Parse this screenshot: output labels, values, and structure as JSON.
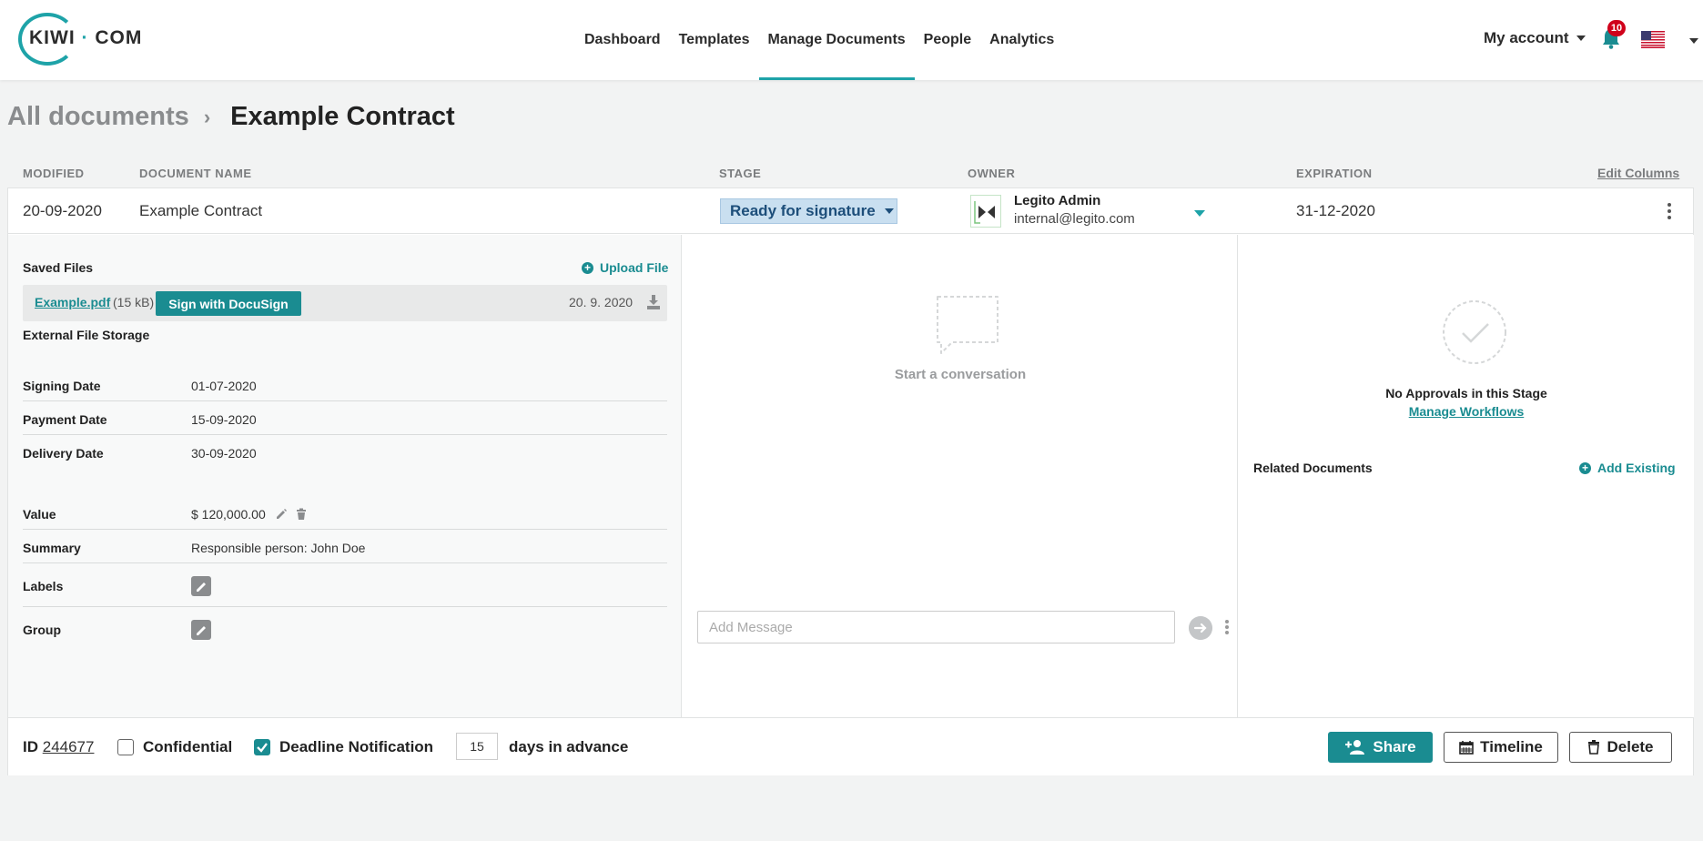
{
  "header": {
    "logo_left": "KIWI",
    "logo_dot": "·",
    "logo_right": "COM",
    "nav": [
      {
        "label": "Dashboard"
      },
      {
        "label": "Templates"
      },
      {
        "label": "Manage Documents",
        "active": true
      },
      {
        "label": "People"
      },
      {
        "label": "Analytics"
      }
    ],
    "account_label": "My account",
    "notification_count": "10",
    "flag_icon": "us-flag-icon"
  },
  "breadcrumb": {
    "parent": "All documents",
    "separator": "›",
    "current": "Example Contract"
  },
  "columns": {
    "modified": "MODIFIED",
    "document_name": "DOCUMENT NAME",
    "stage": "STAGE",
    "owner": "OWNER",
    "expiration": "EXPIRATION",
    "edit_columns": "Edit Columns"
  },
  "document": {
    "modified": "20-09-2020",
    "name": "Example Contract",
    "stage": "Ready for signature",
    "owner_name": "Legito Admin",
    "owner_email": "internal@legito.com",
    "expiration": "31-12-2020"
  },
  "files": {
    "title": "Saved Files",
    "upload_label": "Upload File",
    "file_name": "Example.pdf",
    "file_size": "(15 kB)",
    "sign_button": "Sign with DocuSign",
    "file_date": "20. 9. 2020",
    "external_storage": "External File Storage"
  },
  "fields": {
    "signing_date_label": "Signing Date",
    "signing_date": "01-07-2020",
    "payment_date_label": "Payment Date",
    "payment_date": "15-09-2020",
    "delivery_date_label": "Delivery Date",
    "delivery_date": "30-09-2020",
    "value_label": "Value",
    "value": "$ 120,000.00",
    "summary_label": "Summary",
    "summary": "Responsible person: John Doe",
    "labels_label": "Labels",
    "group_label": "Group"
  },
  "conversation": {
    "empty_text": "Start a conversation",
    "input_placeholder": "Add Message"
  },
  "approvals": {
    "empty_text": "No Approvals in this Stage",
    "manage_link": "Manage Workflows",
    "related_title": "Related Documents",
    "add_existing": "Add Existing"
  },
  "footer": {
    "id_label": "ID",
    "id_value": "244677",
    "confidential_label": "Confidential",
    "confidential_checked": false,
    "deadline_label": "Deadline Notification",
    "deadline_checked": true,
    "days_value": "15",
    "days_suffix": "days in advance",
    "share_label": "Share",
    "timeline_label": "Timeline",
    "delete_label": "Delete"
  },
  "colors": {
    "accent": "#1a8c91",
    "stage_bg": "#c9dff0",
    "badge_red": "#d0021b"
  }
}
